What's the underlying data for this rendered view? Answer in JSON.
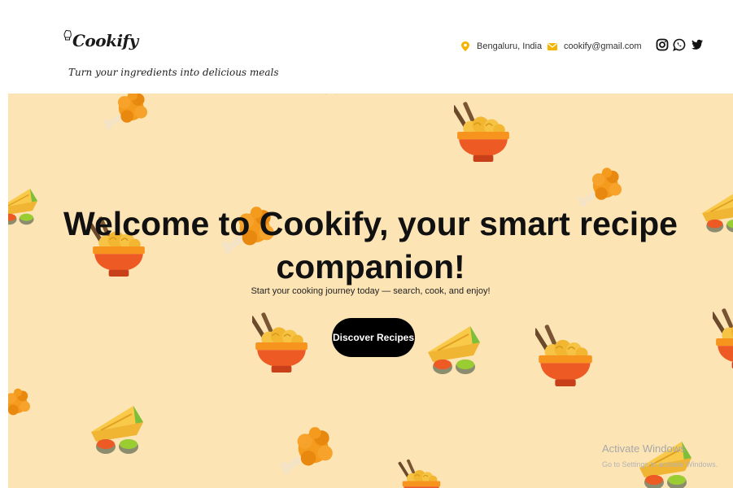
{
  "header": {
    "logo_text": "Cookify",
    "tagline": "Turn your ingredients into delicious meals",
    "location": "Bengaluru, India",
    "email": "cookify@gmail.com",
    "social_icons": [
      "instagram-icon",
      "whatsapp-icon",
      "twitter-icon"
    ]
  },
  "hero": {
    "title": "Welcome to Cookify, your smart recipe companion!",
    "subtitle": "Start your cooking journey today — search, cook, and enjoy!",
    "cta_label": "Discover Recipes",
    "background_color": "#fde4b4",
    "decor_icons": [
      "noodle-bowl-icon",
      "fried-chicken-icon",
      "samosa-icon"
    ]
  },
  "watermark": {
    "title": "Activate Windows",
    "subtitle": "Go to Settings to activate Windows."
  },
  "colors": {
    "accent": "#f4b400",
    "button_bg": "#000000",
    "button_text": "#ffffff"
  }
}
